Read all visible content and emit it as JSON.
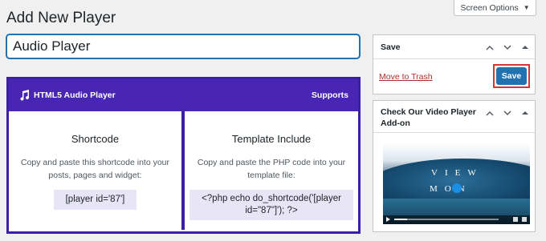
{
  "page": {
    "title": "Add New Player"
  },
  "screen_options": {
    "label": "Screen Options",
    "caret_icon": "caret-down-icon"
  },
  "title_field": {
    "value": "Audio Player"
  },
  "plugin": {
    "brand_icon": "music-note-icon",
    "brand": "HTML5 Audio Player",
    "supports": "Supports",
    "accent_color": "#4826b3",
    "panels": [
      {
        "title": "Shortcode",
        "description": "Copy and paste this shortcode into your posts, pages and widget:",
        "code": "[player id='87']"
      },
      {
        "title": "Template Include",
        "description": "Copy and paste the PHP code into your template file:",
        "code": "<?php echo do_shortcode('[player id=\"87\"]'); ?>"
      }
    ]
  },
  "save_box": {
    "title": "Save",
    "trash_link": "Move to Trash",
    "save_button": "Save",
    "button_color": "#2271b1",
    "highlight_color": "#d63638"
  },
  "video_box": {
    "title": "Check Our Video Player Add-on",
    "thumbnail_line1": "VIEW",
    "thumbnail_line2": "MON"
  }
}
